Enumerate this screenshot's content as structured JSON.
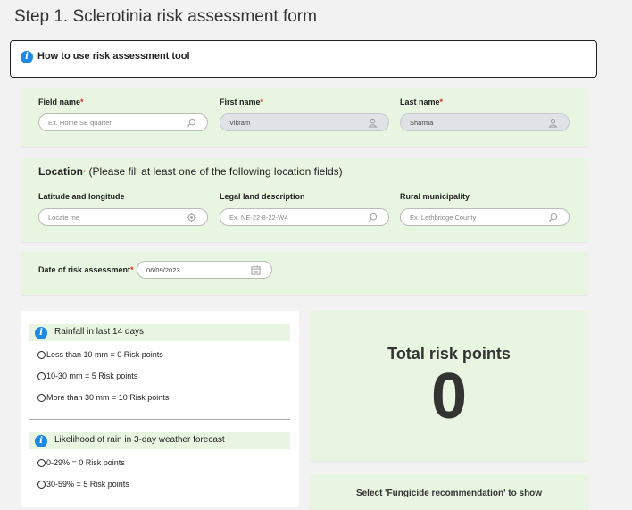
{
  "page_title": "Step 1. Sclerotinia risk assessment form",
  "howto": {
    "label": "How to use risk assessment tool"
  },
  "identity": {
    "field_name": {
      "label": "Field name",
      "placeholder": "Ex. Home SE quarter"
    },
    "first_name": {
      "label": "First name",
      "value": "Vikram"
    },
    "last_name": {
      "label": "Last name",
      "value": "Sharma"
    }
  },
  "location": {
    "title": "Location",
    "note": "(Please fill at least one of the following location fields)",
    "latlon": {
      "label": "Latitude and longitude",
      "placeholder": "Locate me"
    },
    "legal": {
      "label": "Legal land description",
      "placeholder": "Ex. NE-22-8-22-W4"
    },
    "rm": {
      "label": "Rural municipality",
      "placeholder": "Ex. Lethbridge County"
    }
  },
  "date": {
    "label": "Date of risk assessment",
    "value": "06/09/2023"
  },
  "required_mark": "*",
  "rainfall": {
    "title": "Rainfall in last 14 days",
    "options": [
      "Less than 10 mm = 0 Risk points",
      "10-30 mm = 5 Risk points",
      "More than 30 mm = 10 Risk points"
    ]
  },
  "forecast": {
    "title": "Likelihood of rain in 3-day weather forecast",
    "options": [
      "0-29% = 0 Risk points",
      "30-59% = 5 Risk points"
    ]
  },
  "total": {
    "label": "Total risk points",
    "value": "0"
  },
  "fungicide": {
    "text": "Select 'Fungicide recommendation' to show"
  },
  "colors": {
    "panel": "#e8f5e0",
    "info": "#1e88e5",
    "required": "#d32f2f"
  }
}
